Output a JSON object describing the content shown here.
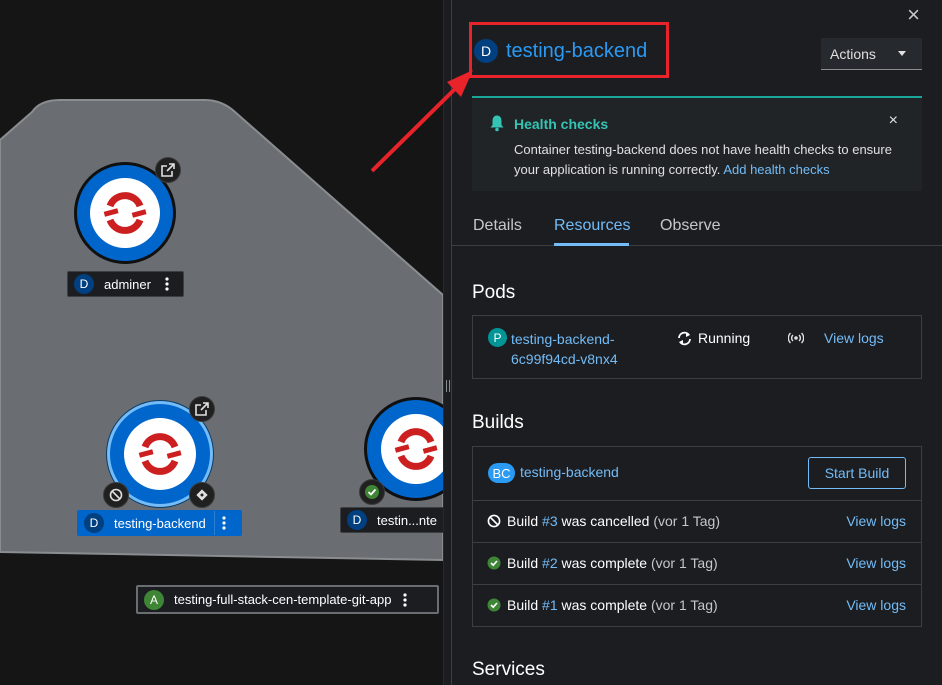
{
  "colors": {
    "accent": "#0066cc",
    "link": "#73bcf7",
    "highlight": "#e8232a",
    "alert_teal": "#35c4b4",
    "success": "#3e8635"
  },
  "topology": {
    "nodes": [
      {
        "badge": "D",
        "name": "adminer"
      },
      {
        "badge": "D",
        "name": "testing-backend"
      },
      {
        "badge": "D",
        "name": "testin...nte"
      }
    ],
    "app_group": {
      "badge": "A",
      "name": "testing-full-stack-cen-template-git-app"
    }
  },
  "panel": {
    "close_icon": "×",
    "badge": "D",
    "title": "testing-backend",
    "actions_label": "Actions",
    "alert": {
      "title": "Health checks",
      "close_icon": "×",
      "body": "Container testing-backend does not have health checks to ensure your application is running correctly.",
      "link": "Add health checks"
    },
    "tabs": [
      "Details",
      "Resources",
      "Observe"
    ],
    "pods": {
      "title": "Pods",
      "badge": "P",
      "name_line1": "testing-backend-",
      "name_line2": "6c99f94cd-v8nx4",
      "status": "Running",
      "view_logs": "View logs"
    },
    "builds": {
      "title": "Builds",
      "badge": "BC",
      "config_name": "testing-backend",
      "start_build": "Start Build",
      "items": [
        {
          "prefix": "Build",
          "number": "#3",
          "status": "was cancelled",
          "time": "(vor 1 Tag)",
          "logs": "View logs"
        },
        {
          "prefix": "Build",
          "number": "#2",
          "status": "was complete",
          "time": "(vor 1 Tag)",
          "logs": "View logs"
        },
        {
          "prefix": "Build",
          "number": "#1",
          "status": "was complete",
          "time": "(vor 1 Tag)",
          "logs": "View logs"
        }
      ]
    },
    "services": {
      "title": "Services"
    }
  }
}
